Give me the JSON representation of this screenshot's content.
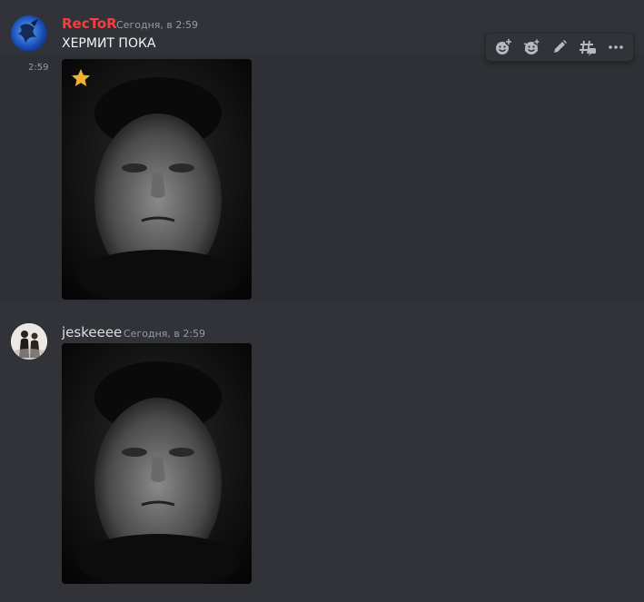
{
  "messages": [
    {
      "author": "RecToR",
      "author_color": "#f23f42",
      "timestamp": "Сегодня, в 2:59",
      "content": "ХЕРМИТ ПОКА",
      "hover_time": "2:59",
      "attachment_icon": "star-icon"
    },
    {
      "author": "jeskeeee",
      "author_color": "#dbdee1",
      "timestamp": "Сегодня, в 2:59",
      "content": "",
      "attachment_icon": ""
    }
  ],
  "toolbar": {
    "buttons": [
      "add-reaction-icon",
      "super-reaction-icon",
      "edit-icon",
      "create-thread-icon",
      "more-icon"
    ]
  },
  "colors": {
    "background": "#313338",
    "hover_background": "#2e3035",
    "timestamp": "#949ba4"
  }
}
